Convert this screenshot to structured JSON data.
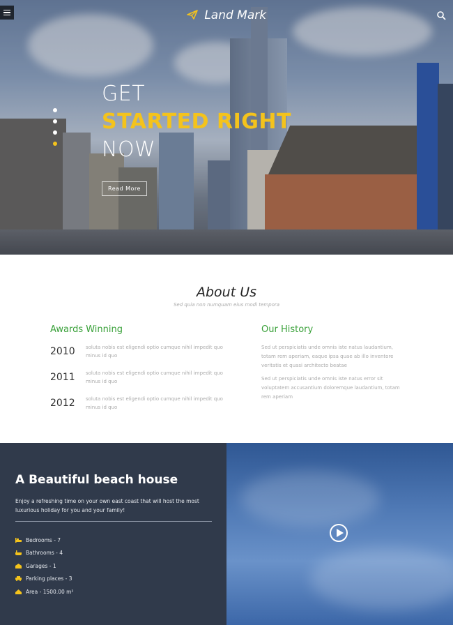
{
  "header": {
    "logo_text": "Land Mark",
    "logo_icon": "paper-plane-icon",
    "menu_icon": "hamburger-icon",
    "search_icon": "search-icon"
  },
  "hero": {
    "line1": "GET",
    "line2": "STARTED RIGHT",
    "line3": "NOW",
    "button_label": "Read More",
    "slides_total": 4,
    "active_slide": 4,
    "accent_color": "#f4c31c"
  },
  "about": {
    "title": "About Us",
    "subtitle": "Sed quia non numquam eius modi tempora",
    "awards": {
      "heading": "Awards Winning",
      "items": [
        {
          "year": "2010",
          "text": "soluta nobis est eligendi optio cumque nihil impedit quo minus id quo"
        },
        {
          "year": "2011",
          "text": "soluta nobis est eligendi optio cumque nihil impedit quo minus id quo"
        },
        {
          "year": "2012",
          "text": "soluta nobis est eligendi optio cumque nihil impedit quo minus id quo"
        }
      ]
    },
    "history": {
      "heading": "Our History",
      "paragraphs": [
        "Sed ut perspiciatis unde omnis iste natus laudantium, totam rem aperiam, eaque ipsa quae ab illo inventore veritatis et quasi architecto beatae",
        "Sed ut perspiciatis unde omnis iste natus error sit voluptatem accusantium doloremque laudantium, totam rem aperiam"
      ]
    },
    "heading_color": "#3aa13a"
  },
  "beach": {
    "title": "A Beautiful beach house",
    "description": "Enjoy a refreshing time on your own east coast that will host the most luxurious holiday for you and your family!",
    "features": [
      {
        "icon": "bed-icon",
        "label": "Bedrooms - 7"
      },
      {
        "icon": "bath-icon",
        "label": "Bathrooms - 4"
      },
      {
        "icon": "garage-icon",
        "label": "Garages - 1"
      },
      {
        "icon": "car-icon",
        "label": "Parking places - 3"
      },
      {
        "icon": "area-icon",
        "label": "Area - 1500.00 m²"
      }
    ],
    "panel_color": "#303a4b"
  },
  "video": {
    "play_icon": "play-icon"
  }
}
